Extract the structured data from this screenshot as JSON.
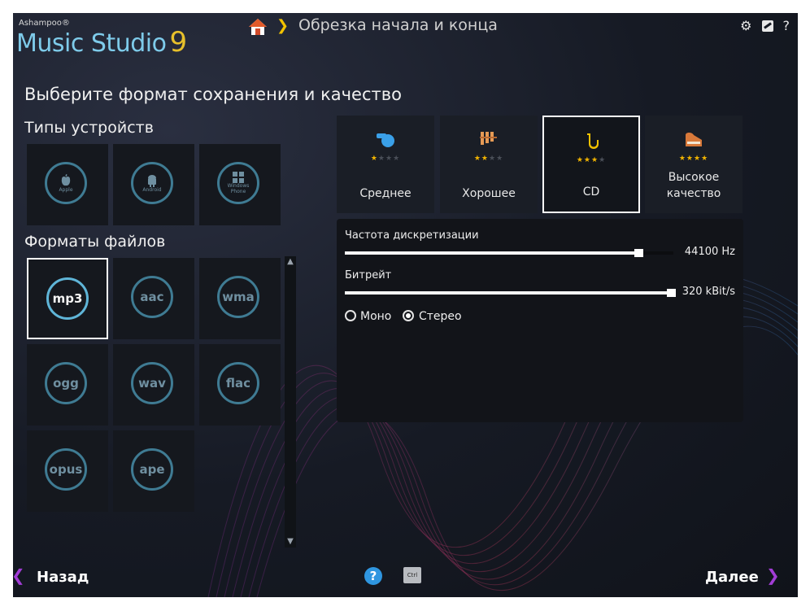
{
  "app": {
    "brand_small": "Ashampoo®",
    "brand_name": "Music Studio",
    "brand_version": "9"
  },
  "breadcrumb": {
    "current": "Обрезка начала и конца"
  },
  "toolbar_icons": [
    "gear-icon",
    "edit-icon",
    "help-icon"
  ],
  "toolbar": {
    "help_text": "?"
  },
  "page": {
    "title": "Выберите формат сохранения и качество",
    "device_types_title": "Типы устройств",
    "file_formats_title": "Форматы файлов"
  },
  "devices": [
    {
      "name": "Apple"
    },
    {
      "name": "Android"
    },
    {
      "name": "Windows Phone"
    }
  ],
  "formats": [
    {
      "label": "mp3",
      "selected": true
    },
    {
      "label": "aac",
      "selected": false
    },
    {
      "label": "wma",
      "selected": false
    },
    {
      "label": "ogg",
      "selected": false
    },
    {
      "label": "wav",
      "selected": false
    },
    {
      "label": "flac",
      "selected": false
    },
    {
      "label": "opus",
      "selected": false
    },
    {
      "label": "ape",
      "selected": false
    }
  ],
  "quality": [
    {
      "label": "Среднее",
      "stars": 1,
      "icon": "whistle-icon",
      "selected": false
    },
    {
      "label": "Хорошее",
      "stars": 2,
      "icon": "xylophone-icon",
      "selected": false
    },
    {
      "label": "CD",
      "stars": 3,
      "icon": "saxophone-icon",
      "selected": true
    },
    {
      "label": "Высокое качество",
      "stars": 4,
      "icon": "piano-icon",
      "selected": false
    }
  ],
  "settings": {
    "sample_rate_label": "Частота дискретизации",
    "sample_rate_value": "44100 Hz",
    "sample_rate_fraction": 0.9,
    "bitrate_label": "Битрейт",
    "bitrate_value": "320 kBit/s",
    "bitrate_fraction": 1.0,
    "mono_label": "Моно",
    "stereo_label": "Стерео",
    "channel_selected": "stereo"
  },
  "footer": {
    "back_label": "Назад",
    "next_label": "Далее",
    "help_label": "?",
    "ctrl_label": "Ctrl"
  },
  "colors": {
    "accent": "#a23dd6",
    "logo_blue": "#7ecbea",
    "logo_yellow": "#e7c02b",
    "star": "#f2b400",
    "ring": "#3f7b93"
  }
}
